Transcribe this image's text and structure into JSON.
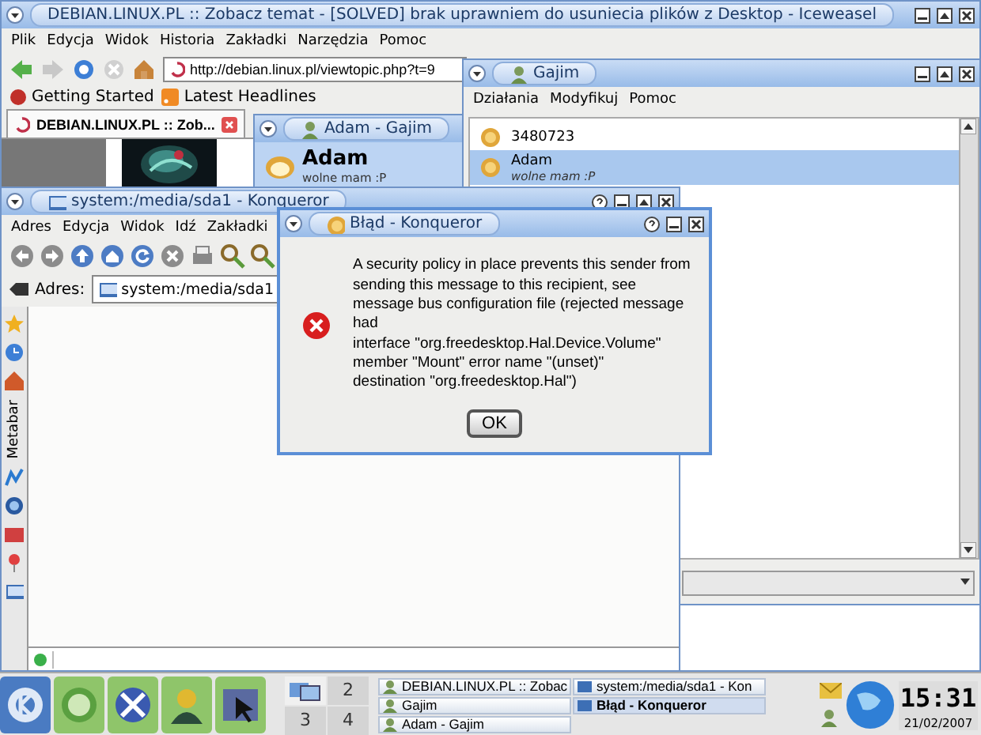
{
  "browser": {
    "title": "DEBIAN.LINUX.PL :: Zobacz temat - [SOLVED] brak uprawniem do usuniecia plików z Desktop - Iceweasel",
    "menu": [
      "Plik",
      "Edycja",
      "Widok",
      "Historia",
      "Zakładki",
      "Narzędzia",
      "Pomoc"
    ],
    "address": "http://debian.linux.pl/viewtopic.php?t=9",
    "bookmarks": [
      "Getting Started",
      "Latest Headlines"
    ],
    "tabs": [
      {
        "label": "DEBIAN.LINUX.PL :: Zob...",
        "selected": true
      }
    ]
  },
  "chat_window": {
    "title": "Adam - Gajim",
    "contact": "Adam",
    "status": "wolne mam :P"
  },
  "roster": {
    "title": "Gajim",
    "menu": [
      "Działania",
      "Modyfikuj",
      "Pomoc"
    ],
    "contacts": [
      {
        "name": "3480723",
        "selected": false
      },
      {
        "name": "Adam",
        "status": "wolne mam :P",
        "selected": true
      }
    ]
  },
  "file_manager": {
    "title": "system:/media/sda1 - Konqueror",
    "menu": [
      "Adres",
      "Edycja",
      "Widok",
      "Idź",
      "Zakładki"
    ],
    "location_label": "Adres:",
    "location": "system:/media/sda1",
    "sidebar_label": "Metabar"
  },
  "dialog": {
    "title": "Błąd - Konqueror",
    "message_lines": [
      "A security policy in place prevents this sender from",
      "sending this message to this recipient, see",
      "message bus configuration file (rejected message",
      "had",
      "interface \"org.freedesktop.Hal.Device.Volume\"",
      "member \"Mount\" error name \"(unset)\"",
      "destination \"org.freedesktop.Hal\")"
    ],
    "button": "OK"
  },
  "taskbar": {
    "desktops": [
      {
        "kind": "preview",
        "selected": true
      },
      {
        "kind": "number",
        "label": "2",
        "selected": false
      },
      {
        "kind": "number",
        "label": "3",
        "selected": false
      },
      {
        "kind": "number",
        "label": "4",
        "selected": false
      }
    ],
    "tasks": [
      {
        "label": "DEBIAN.LINUX.PL :: Zobac",
        "selected": false
      },
      {
        "label": "Gajim",
        "selected": false
      },
      {
        "label": "Adam - Gajim",
        "selected": false
      },
      {
        "label": "system:/media/sda1 - Kon",
        "selected": false
      },
      {
        "label": "Błąd - Konqueror",
        "selected": true
      }
    ],
    "clock": {
      "time": "15:31",
      "date": "21/02/2007"
    }
  }
}
